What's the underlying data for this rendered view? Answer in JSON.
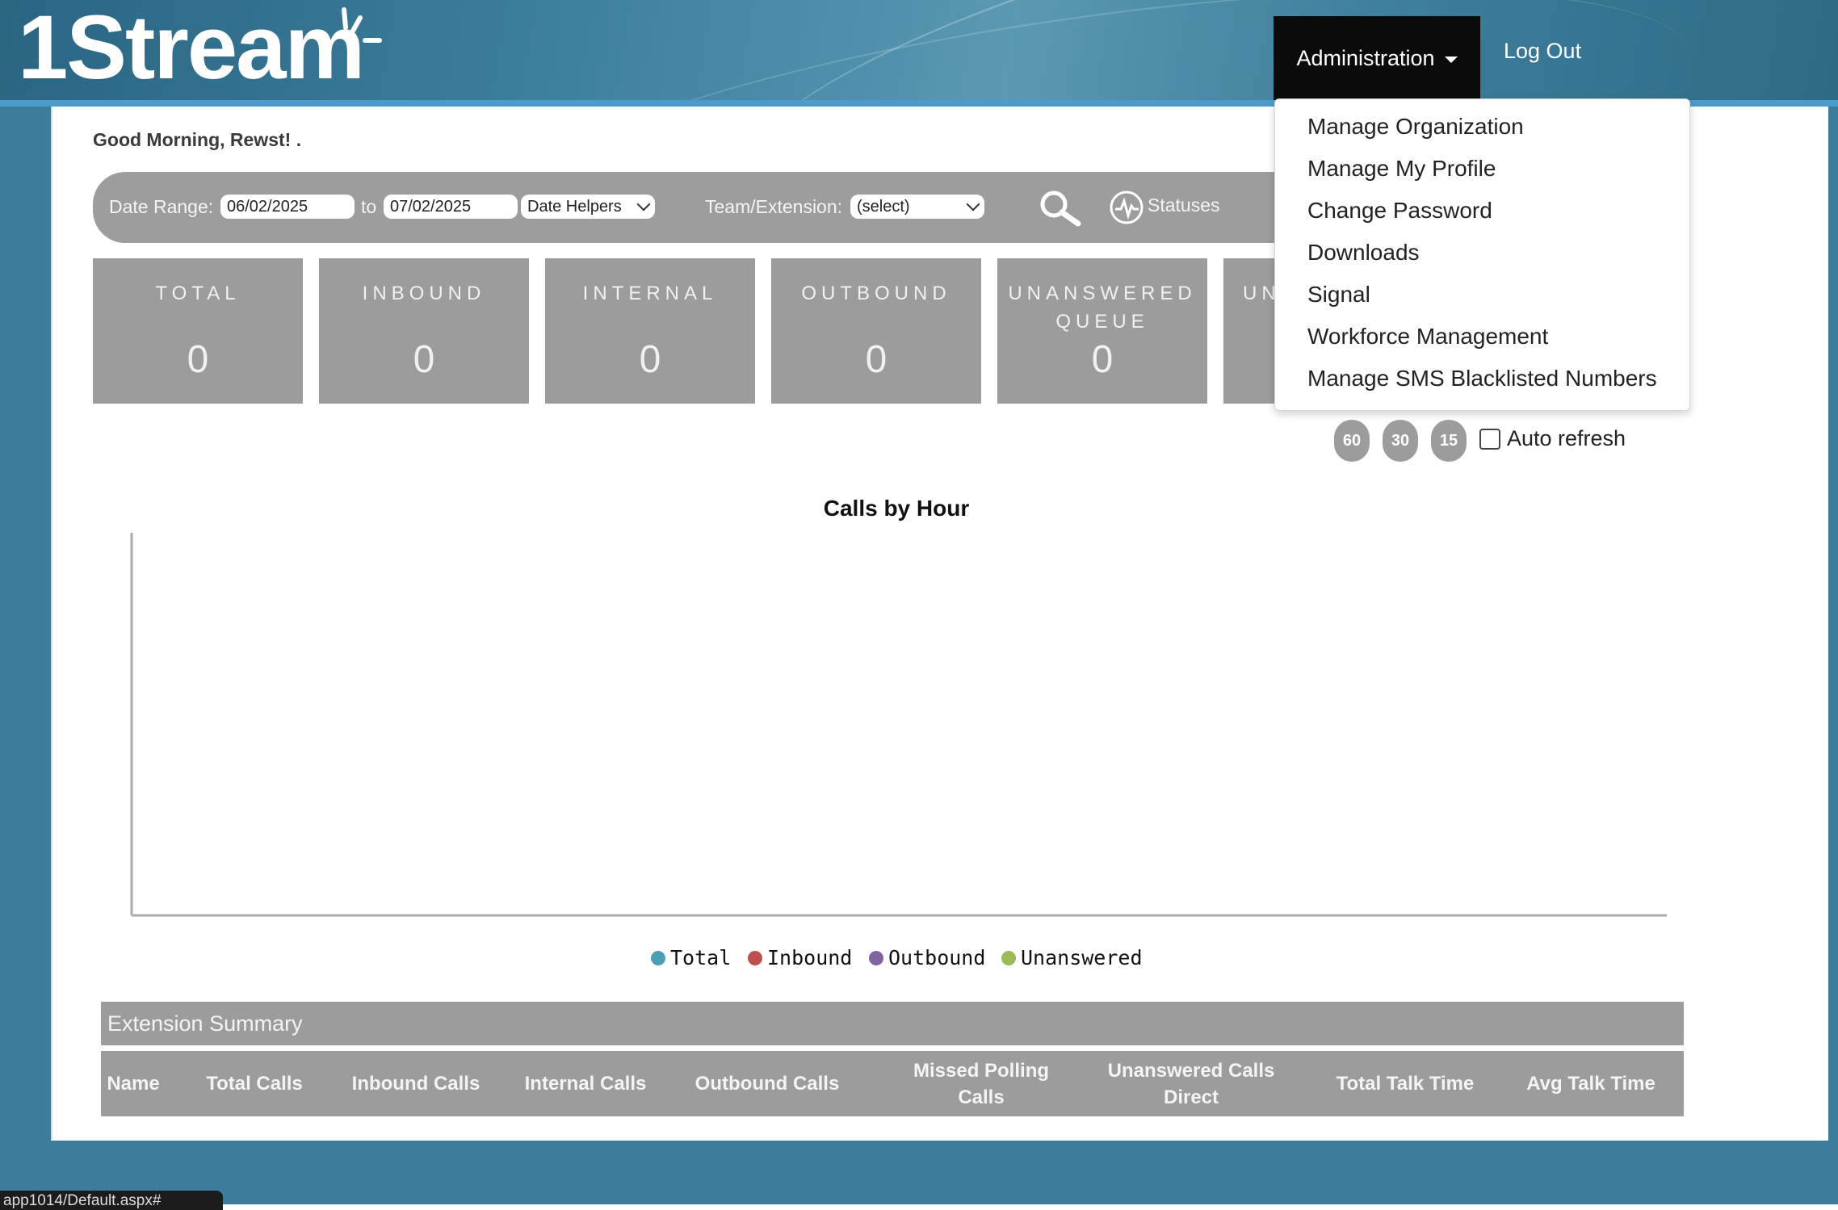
{
  "header": {
    "logo_text": "1Stream",
    "admin_label": "Administration",
    "logout_label": "Log Out"
  },
  "admin_menu": {
    "items": [
      "Manage Organization",
      "Manage My Profile",
      "Change Password",
      "Downloads",
      "Signal",
      "Workforce Management",
      "Manage SMS Blacklisted Numbers"
    ]
  },
  "greeting": "Good Morning, Rewst!  .",
  "filters": {
    "date_range_label": "Date Range:",
    "start_date": "06/02/2025",
    "to_label": "to",
    "end_date": "07/02/2025",
    "date_helpers": "Date Helpers",
    "team_label": "Team/Extension:",
    "team_value": "(select)",
    "statuses_label": "Statuses"
  },
  "cards": [
    {
      "label": "TOTAL",
      "value": "0"
    },
    {
      "label": "INBOUND",
      "value": "0"
    },
    {
      "label": "INTERNAL",
      "value": "0"
    },
    {
      "label": "OUTBOUND",
      "value": "0"
    },
    {
      "label": "UNANSWERED QUEUE",
      "value": "0"
    },
    {
      "label": "UN",
      "value": ""
    }
  ],
  "refresh": {
    "options": [
      "60",
      "30",
      "15"
    ],
    "auto_label": "Auto refresh",
    "checked": false
  },
  "chart_data": {
    "type": "line",
    "title": "Calls by Hour",
    "categories": [],
    "series": [
      {
        "name": "Total",
        "color": "#4a9fb5",
        "values": []
      },
      {
        "name": "Inbound",
        "color": "#c0504d",
        "values": []
      },
      {
        "name": "Outbound",
        "color": "#8064a2",
        "values": []
      },
      {
        "name": "Unanswered",
        "color": "#9bbb59",
        "values": []
      }
    ],
    "grid": false,
    "legend": "bottom"
  },
  "extension_summary": {
    "title": "Extension Summary",
    "columns": [
      "Name",
      "Total Calls",
      "Inbound Calls",
      "Internal Calls",
      "Outbound Calls",
      "Missed Polling Calls",
      "Unanswered Calls Direct",
      "Total Talk Time",
      "Avg Talk Time"
    ]
  },
  "status_bar_text": "app1014/Default.aspx#"
}
